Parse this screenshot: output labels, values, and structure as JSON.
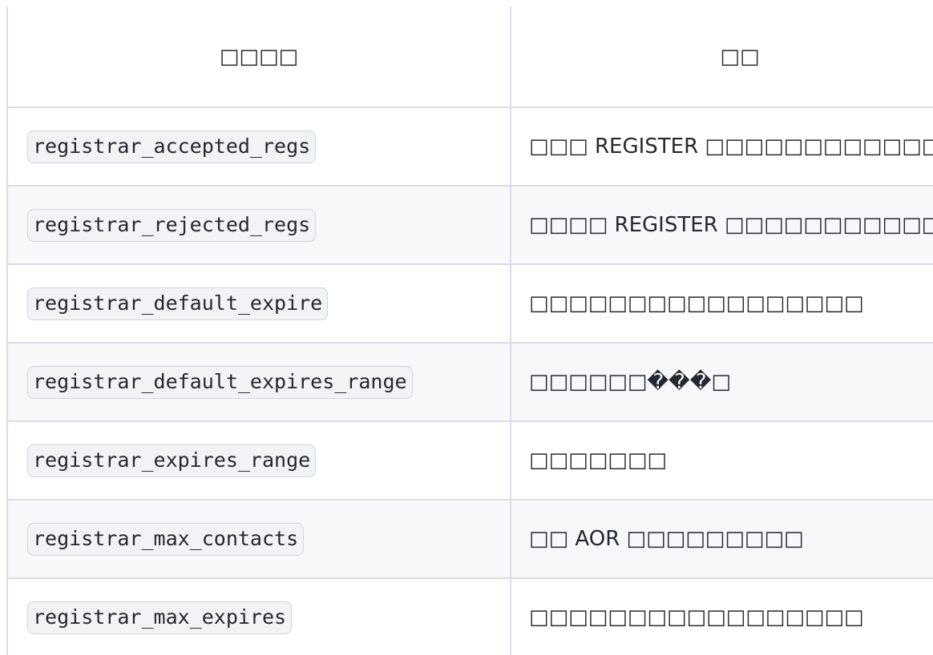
{
  "table": {
    "headers": [
      "□□□□",
      "□□"
    ],
    "rows": [
      {
        "name": "registrar_accepted_regs",
        "description": "□□□ REGISTER □□□□□□□□□□□□"
      },
      {
        "name": "registrar_rejected_regs",
        "description": "□□□□ REGISTER □□□□□□□□□□□□"
      },
      {
        "name": "registrar_default_expire",
        "description": "□□□□□□□□□□□□□□□□□"
      },
      {
        "name": "registrar_default_expires_range",
        "description": "□□□□□□���□"
      },
      {
        "name": "registrar_expires_range",
        "description": "□□□□□□□"
      },
      {
        "name": "registrar_max_contacts",
        "description": "□□ AOR □□□□□□□□□"
      },
      {
        "name": "registrar_max_expires",
        "description": "□□□□□□□□□□□□□□□□□"
      }
    ]
  }
}
